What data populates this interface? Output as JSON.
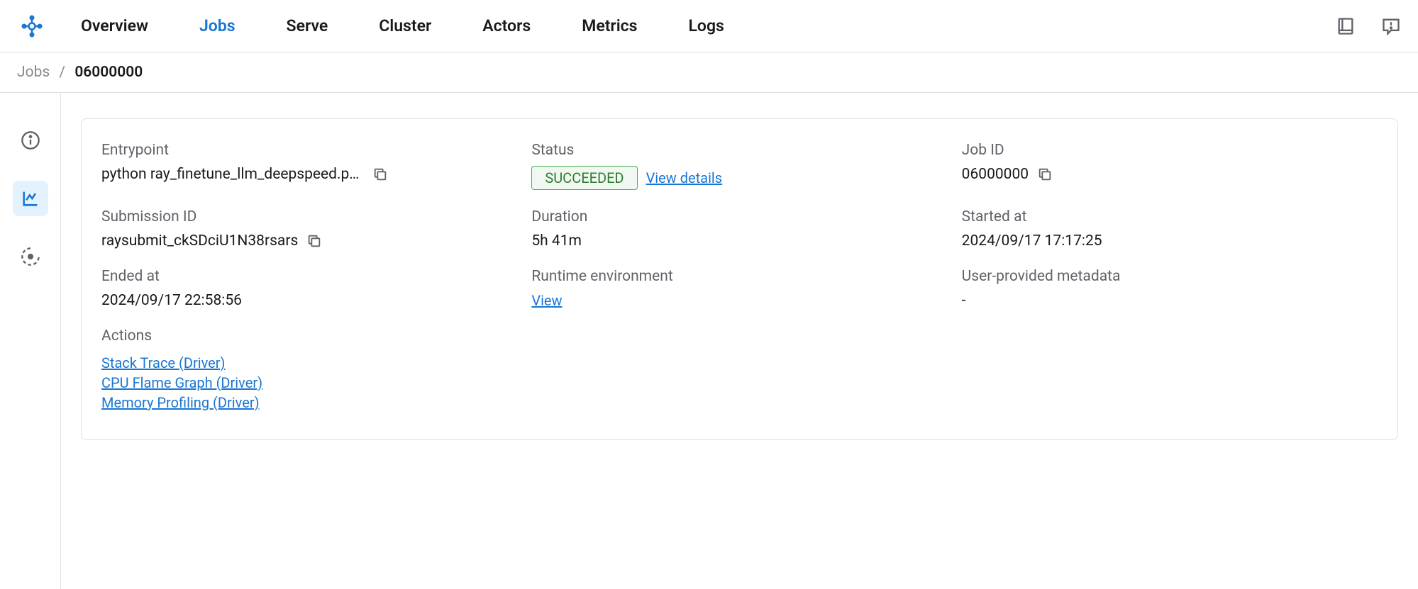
{
  "nav": {
    "tabs": [
      "Overview",
      "Jobs",
      "Serve",
      "Cluster",
      "Actors",
      "Metrics",
      "Logs"
    ],
    "active": "Jobs"
  },
  "breadcrumb": {
    "parent": "Jobs",
    "current": "06000000"
  },
  "fields": {
    "entrypoint": {
      "label": "Entrypoint",
      "value": "python ray_finetune_llm_deepspeed.py --…"
    },
    "status": {
      "label": "Status",
      "badge": "SUCCEEDED",
      "details_link": "View details"
    },
    "job_id": {
      "label": "Job ID",
      "value": "06000000"
    },
    "submission_id": {
      "label": "Submission ID",
      "value": "raysubmit_ckSDciU1N38rsars"
    },
    "duration": {
      "label": "Duration",
      "value": "5h 41m"
    },
    "started_at": {
      "label": "Started at",
      "value": "2024/09/17 17:17:25"
    },
    "ended_at": {
      "label": "Ended at",
      "value": "2024/09/17 22:58:56"
    },
    "runtime_env": {
      "label": "Runtime environment",
      "link": "View"
    },
    "user_metadata": {
      "label": "User-provided metadata",
      "value": "-"
    },
    "actions": {
      "label": "Actions",
      "links": [
        "Stack Trace (Driver)",
        "CPU Flame Graph (Driver)",
        "Memory Profiling (Driver)"
      ]
    }
  }
}
